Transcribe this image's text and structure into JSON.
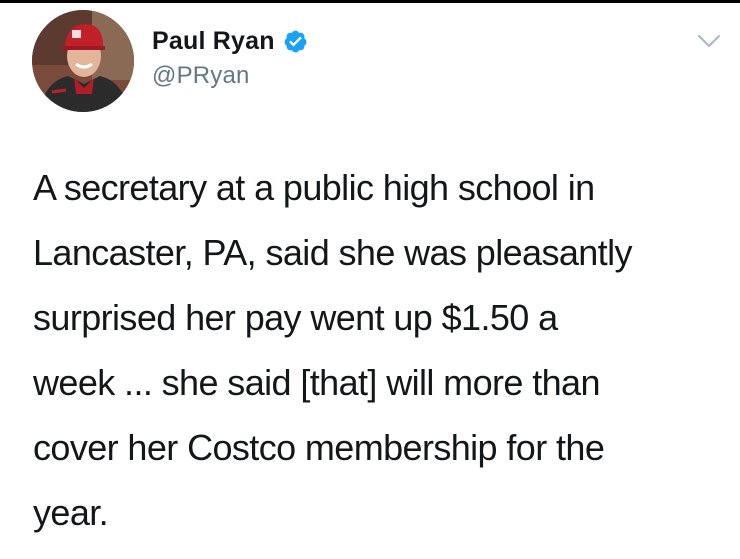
{
  "tweet": {
    "author": {
      "display_name": "Paul Ryan",
      "handle": "@PRyan",
      "verified": true
    },
    "text_lines": [
      "A secretary at a public high school in",
      "Lancaster, PA, said she was pleasantly",
      "surprised her pay went up $1.50 a",
      "week ... she said [that] will more than",
      "cover her Costco membership for the",
      "year."
    ]
  },
  "icons": {
    "verified": "verified-badge-icon",
    "menu": "chevron-down-icon"
  },
  "colors": {
    "text": "#14171a",
    "handle": "#657786",
    "verified_blue": "#1da1f2",
    "chevron": "#aab8c2"
  }
}
